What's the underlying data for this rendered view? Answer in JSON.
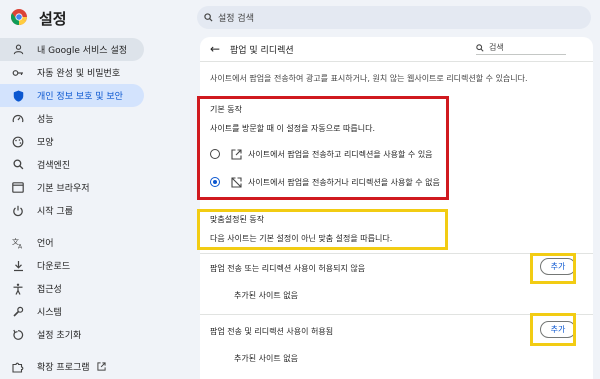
{
  "app": {
    "title": "설정"
  },
  "search": {
    "placeholder": "설정 검색"
  },
  "sidebar": {
    "items": [
      {
        "label": "내 Google 서비스 설정",
        "icon": "person-icon"
      },
      {
        "label": "자동 완성 및 비밀번호",
        "icon": "key-icon"
      },
      {
        "label": "개인 정보 보호 및 보안",
        "icon": "shield-icon"
      },
      {
        "label": "성능",
        "icon": "speedometer-icon"
      },
      {
        "label": "모양",
        "icon": "palette-icon"
      },
      {
        "label": "검색엔진",
        "icon": "search-icon"
      },
      {
        "label": "기본 브라우저",
        "icon": "browser-icon"
      },
      {
        "label": "시작 그룹",
        "icon": "power-icon"
      },
      {
        "label": "언어",
        "icon": "translate-icon"
      },
      {
        "label": "다운로드",
        "icon": "download-icon"
      },
      {
        "label": "접근성",
        "icon": "accessibility-icon"
      },
      {
        "label": "시스템",
        "icon": "wrench-icon"
      },
      {
        "label": "설정 초기화",
        "icon": "reset-icon"
      },
      {
        "label": "확장 프로그램",
        "icon": "puzzle-icon",
        "external_icon": "open-in-new-icon"
      }
    ],
    "active_index": 2
  },
  "panel": {
    "title": "팝업 및 리디렉션",
    "search_label": "검색",
    "description": "사이트에서 팝업을 전송하여 광고를 표시하거나, 원치 않는 웹사이트로 리디렉션할 수 있습니다.",
    "default_behavior": {
      "label": "기본 동작",
      "sub": "사이트를 방문할 때 이 설정을 자동으로 따릅니다.",
      "options": [
        {
          "label": "사이트에서 팝업을 전송하고 리디렉션을 사용할 수 있음",
          "checked": false,
          "icon": "open-in-new-icon"
        },
        {
          "label": "사이트에서 팝업을 전송하거나 리디렉션을 사용할 수 없음",
          "checked": true,
          "icon": "popup-blocked-icon"
        }
      ]
    },
    "custom_behavior": {
      "label": "맞춤설정된 동작",
      "sub": "다음 사이트는 기본 설정이 아닌 맞춤 설정을 따릅니다."
    },
    "block_list": {
      "title": "팝업 전송 또는 리디렉션 사용이 허용되지 않음",
      "empty": "추가된 사이트 없음",
      "add_label": "추가"
    },
    "allow_list": {
      "title": "팝업 전송 및 리디렉션 사용이 허용됨",
      "empty": "추가된 사이트 없음",
      "add_label": "추가"
    }
  },
  "colors": {
    "accent": "#0b57d0",
    "highlight_red": "#d0191f",
    "highlight_yellow": "#f2cc13"
  }
}
